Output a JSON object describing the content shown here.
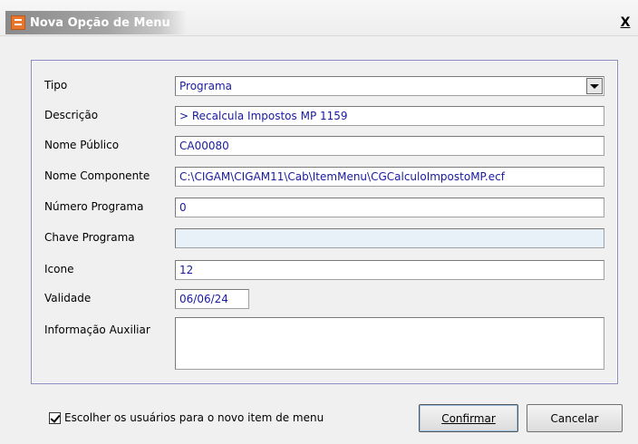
{
  "window": {
    "title": "Nova Opção de Menu",
    "close_label": "X"
  },
  "form": {
    "tipo": {
      "label": "Tipo",
      "value": "Programa"
    },
    "descricao": {
      "label": "Descrição",
      "value": "> Recalcula Impostos MP 1159"
    },
    "nome_publico": {
      "label": "Nome Público",
      "value": "CA00080"
    },
    "nome_componente": {
      "label": "Nome Componente",
      "value": "C:\\CIGAM\\CIGAM11\\Cab\\ItemMenu\\CGCalculoImpostoMP.ecf"
    },
    "numero_programa": {
      "label": "Número Programa",
      "value": "0"
    },
    "chave_programa": {
      "label": "Chave Programa",
      "value": ""
    },
    "icone": {
      "label": "Icone",
      "value": "12"
    },
    "validade": {
      "label": "Validade",
      "value": "06/06/24"
    },
    "informacao_auxiliar": {
      "label": "Informação Auxiliar",
      "value": ""
    }
  },
  "footer": {
    "checkbox_label": "Escolher os usuários para o novo item de menu",
    "checkbox_checked": true,
    "confirm_label": "Confirmar",
    "cancel_label": "Cancelar"
  },
  "colors": {
    "field_text": "#1a1aa0",
    "disabled_field": "#e8f0f8",
    "group_border": "#8c8cc0"
  },
  "icons": {
    "app": "app-menu-icon",
    "close": "close-icon",
    "dropdown": "chevron-down-icon",
    "checkbox": "checkmark-icon"
  }
}
